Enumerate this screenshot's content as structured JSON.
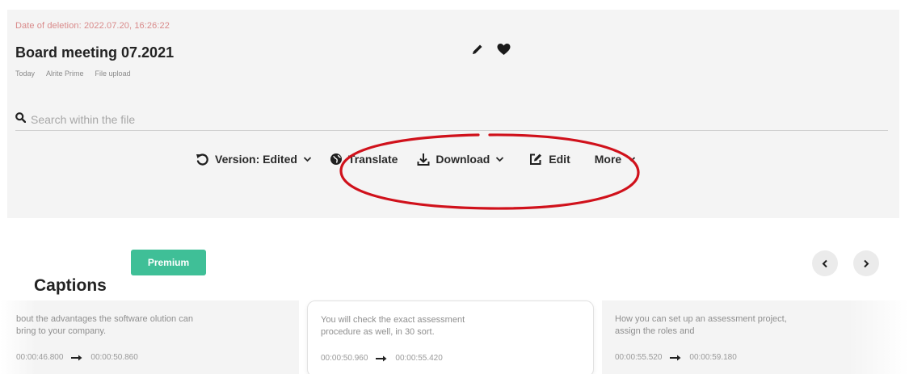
{
  "file": {
    "deletion_date": "Date of deletion: 2022.07.20, 16:26:22",
    "title": "Board meeting 07.2021",
    "meta": [
      "Today",
      "Alrite Prime",
      "File upload"
    ]
  },
  "icons": {
    "edit": "pencil-icon",
    "favorite": "heart-icon",
    "search": "search-icon"
  },
  "search": {
    "placeholder": "Search within the file"
  },
  "toolbar": {
    "version_label": "Version: Edited",
    "translate_label": "Translate",
    "download_label": "Download",
    "edit_label": "Edit",
    "more_label": "More"
  },
  "annotation": {
    "color": "#d0111b"
  },
  "captions": {
    "heading": "Captions",
    "badge": "Premium",
    "badge_color": "#3fbf97",
    "items": [
      {
        "text": "bout the advantages the software olution can bring to your company.",
        "start": "00:00:46.800",
        "end": "00:00:50.860"
      },
      {
        "text": "You will check the exact assessment procedure as well, in 30 sort.",
        "start": "00:00:50.960",
        "end": "00:00:55.420"
      },
      {
        "text": "How you can set up an assessment project, assign the roles and",
        "start": "00:00:55.520",
        "end": "00:00:59.180"
      }
    ]
  }
}
